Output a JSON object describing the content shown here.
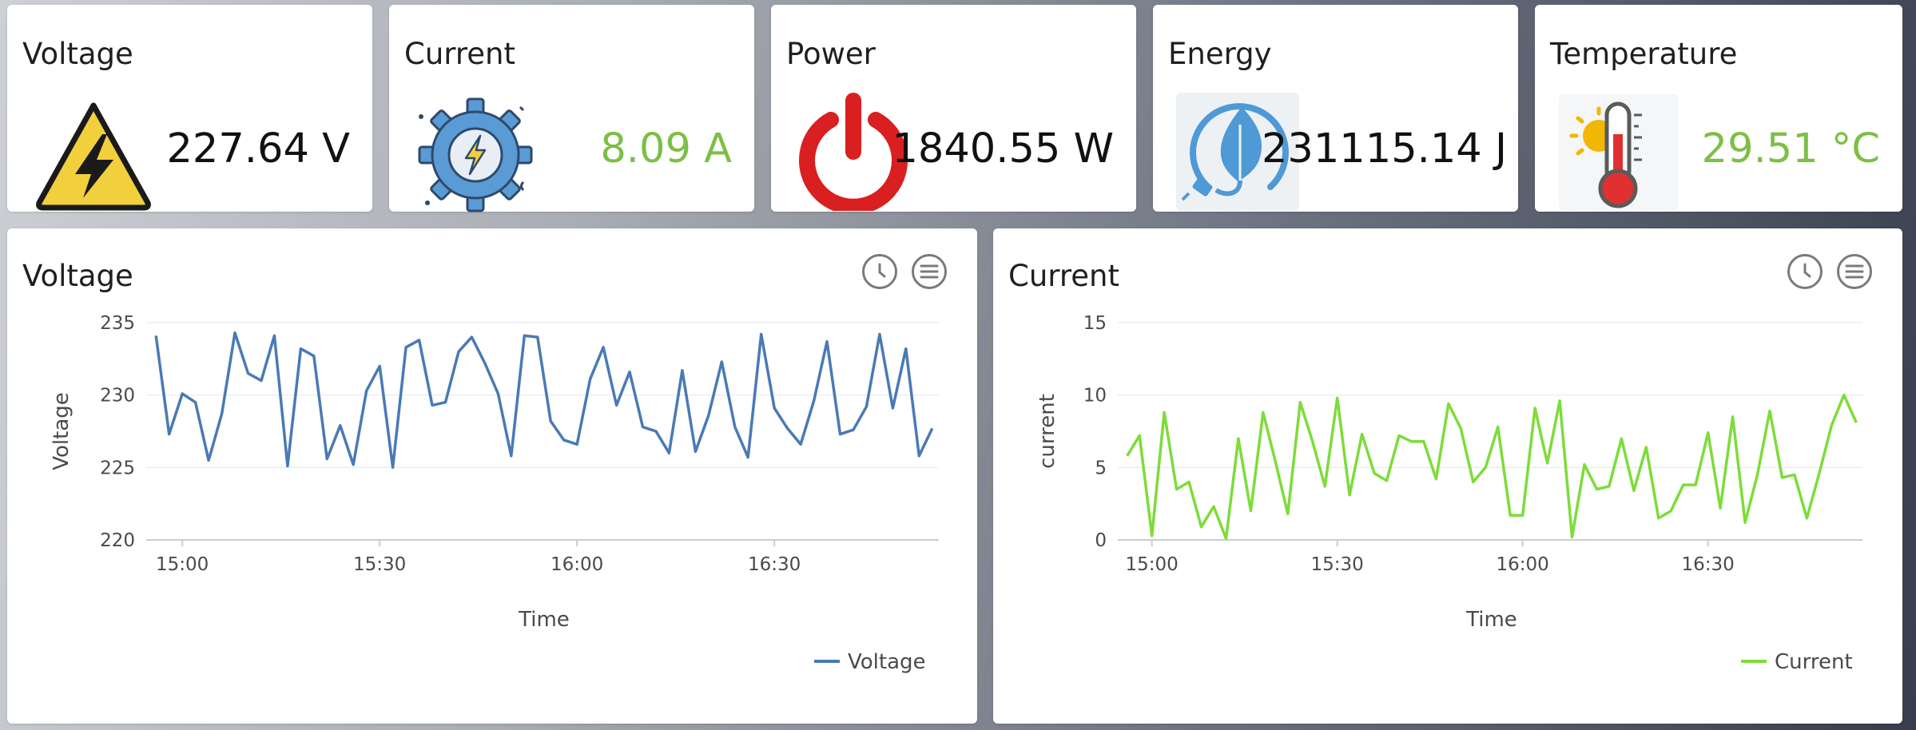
{
  "colors": {
    "value_dark": "#111111",
    "value_green": "#7cbf45",
    "voltage_line": "#4a7ab5",
    "current_line": "#7ddc3a"
  },
  "stats": {
    "voltage": {
      "title": "Voltage",
      "value": "227.64 V",
      "icon": "high-voltage-warning-icon"
    },
    "current": {
      "title": "Current",
      "value": "8.09 A",
      "icon": "electric-gear-icon"
    },
    "power": {
      "title": "Power",
      "value": "1840.55 W",
      "icon": "power-button-icon"
    },
    "energy": {
      "title": "Energy",
      "value": "231115.14 J",
      "icon": "eco-energy-plug-icon"
    },
    "temperature": {
      "title": "Temperature",
      "value": "29.51 °C",
      "icon": "thermometer-sun-icon"
    }
  },
  "panels": {
    "voltage": {
      "title": "Voltage",
      "history_icon": "clock-icon",
      "menu_icon": "menu-icon"
    },
    "current": {
      "title": "Current",
      "history_icon": "clock-icon",
      "menu_icon": "menu-icon"
    }
  },
  "chart_data": [
    {
      "type": "line",
      "xlabel": "Time",
      "ylabel": "Voltage",
      "ylim": [
        220,
        235
      ],
      "yticks": [
        220,
        225,
        230,
        235
      ],
      "xticks": [
        "15:00",
        "15:30",
        "16:00",
        "16:30"
      ],
      "xrange": [
        "14:55",
        "16:55"
      ],
      "legend": "bottom-right",
      "series": [
        {
          "name": "Voltage",
          "color": "#4a7ab5",
          "x": [
            "14:56",
            "14:58",
            "15:00",
            "15:02",
            "15:04",
            "15:06",
            "15:08",
            "15:10",
            "15:12",
            "15:14",
            "15:16",
            "15:18",
            "15:20",
            "15:22",
            "15:24",
            "15:26",
            "15:28",
            "15:30",
            "15:32",
            "15:34",
            "15:36",
            "15:38",
            "15:40",
            "15:42",
            "15:44",
            "15:46",
            "15:48",
            "15:50",
            "15:52",
            "15:54",
            "15:56",
            "15:58",
            "16:00",
            "16:02",
            "16:04",
            "16:06",
            "16:08",
            "16:10",
            "16:12",
            "16:14",
            "16:16",
            "16:18",
            "16:20",
            "16:22",
            "16:24",
            "16:26",
            "16:28",
            "16:30",
            "16:32",
            "16:34",
            "16:36",
            "16:38",
            "16:40",
            "16:42",
            "16:44",
            "16:46",
            "16:48",
            "16:50",
            "16:52",
            "16:54"
          ],
          "y": [
            234.1,
            227.3,
            230.1,
            229.5,
            225.5,
            228.7,
            234.3,
            231.5,
            231.0,
            234.1,
            225.1,
            233.2,
            232.7,
            225.6,
            227.9,
            225.2,
            230.3,
            232.0,
            225.0,
            233.3,
            233.8,
            229.3,
            229.5,
            233.0,
            234.0,
            232.2,
            230.1,
            225.8,
            234.1,
            234.0,
            228.2,
            226.9,
            226.6,
            231.1,
            233.3,
            229.3,
            231.6,
            227.8,
            227.5,
            226.0,
            231.7,
            226.1,
            228.6,
            232.3,
            227.8,
            225.7,
            234.2,
            229.1,
            227.7,
            226.6,
            229.6,
            233.7,
            227.3,
            227.6,
            229.2,
            234.2,
            229.1,
            233.2,
            225.8,
            227.7
          ]
        }
      ]
    },
    {
      "type": "line",
      "xlabel": "Time",
      "ylabel": "current",
      "ylim": [
        0,
        15
      ],
      "yticks": [
        0,
        5,
        10,
        15
      ],
      "xticks": [
        "15:00",
        "15:30",
        "16:00",
        "16:30"
      ],
      "xrange": [
        "14:55",
        "16:55"
      ],
      "legend": "bottom-right",
      "series": [
        {
          "name": "Current",
          "color": "#7ddc3a",
          "x": [
            "14:56",
            "14:58",
            "15:00",
            "15:02",
            "15:04",
            "15:06",
            "15:08",
            "15:10",
            "15:12",
            "15:14",
            "15:16",
            "15:18",
            "15:20",
            "15:22",
            "15:24",
            "15:26",
            "15:28",
            "15:30",
            "15:32",
            "15:34",
            "15:36",
            "15:38",
            "15:40",
            "15:42",
            "15:44",
            "15:46",
            "15:48",
            "15:50",
            "15:52",
            "15:54",
            "15:56",
            "15:58",
            "16:00",
            "16:02",
            "16:04",
            "16:06",
            "16:08",
            "16:10",
            "16:12",
            "16:14",
            "16:16",
            "16:18",
            "16:20",
            "16:22",
            "16:24",
            "16:26",
            "16:28",
            "16:30",
            "16:32",
            "16:34",
            "16:36",
            "16:38",
            "16:40",
            "16:42",
            "16:44",
            "16:46",
            "16:48",
            "16:50",
            "16:52",
            "16:54"
          ],
          "y": [
            5.8,
            7.2,
            0.3,
            8.8,
            3.5,
            4.0,
            0.9,
            2.3,
            0.1,
            7.0,
            2.0,
            8.8,
            5.4,
            1.8,
            9.5,
            6.8,
            3.7,
            9.8,
            3.1,
            7.3,
            4.6,
            4.1,
            7.2,
            6.8,
            6.8,
            4.2,
            9.4,
            7.7,
            4.0,
            5.0,
            7.8,
            1.7,
            1.7,
            9.1,
            5.3,
            9.6,
            0.2,
            5.2,
            3.5,
            3.7,
            7.0,
            3.4,
            6.4,
            1.5,
            2.0,
            3.8,
            3.8,
            7.4,
            2.2,
            8.5,
            1.2,
            4.5,
            8.9,
            4.3,
            4.5,
            1.5,
            4.6,
            7.9,
            10.0,
            8.1
          ]
        }
      ]
    }
  ]
}
